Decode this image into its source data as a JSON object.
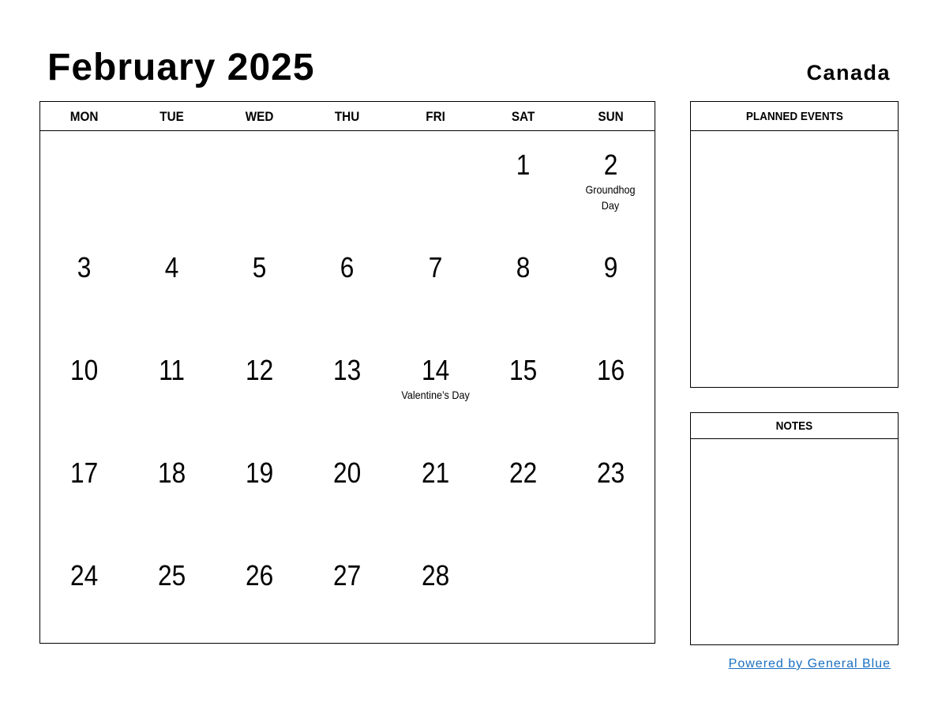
{
  "header": {
    "title": "February 2025",
    "country": "Canada"
  },
  "calendar": {
    "weekdays": [
      "MON",
      "TUE",
      "WED",
      "THU",
      "FRI",
      "SAT",
      "SUN"
    ],
    "weeks": [
      [
        {
          "day": ""
        },
        {
          "day": ""
        },
        {
          "day": ""
        },
        {
          "day": ""
        },
        {
          "day": ""
        },
        {
          "day": "1"
        },
        {
          "day": "2",
          "event": "Groundhog Day"
        }
      ],
      [
        {
          "day": "3"
        },
        {
          "day": "4"
        },
        {
          "day": "5"
        },
        {
          "day": "6"
        },
        {
          "day": "7"
        },
        {
          "day": "8"
        },
        {
          "day": "9"
        }
      ],
      [
        {
          "day": "10"
        },
        {
          "day": "11"
        },
        {
          "day": "12"
        },
        {
          "day": "13"
        },
        {
          "day": "14",
          "event": "Valentine’s Day"
        },
        {
          "day": "15"
        },
        {
          "day": "16"
        }
      ],
      [
        {
          "day": "17"
        },
        {
          "day": "18"
        },
        {
          "day": "19"
        },
        {
          "day": "20"
        },
        {
          "day": "21"
        },
        {
          "day": "22"
        },
        {
          "day": "23"
        }
      ],
      [
        {
          "day": "24"
        },
        {
          "day": "25"
        },
        {
          "day": "26"
        },
        {
          "day": "27"
        },
        {
          "day": "28"
        },
        {
          "day": ""
        },
        {
          "day": ""
        }
      ]
    ]
  },
  "panels": {
    "planned_events_title": "PLANNED EVENTS",
    "notes_title": "NOTES"
  },
  "footer": {
    "link_text": "Powered by General Blue",
    "link_color": "#1a6fc0"
  }
}
